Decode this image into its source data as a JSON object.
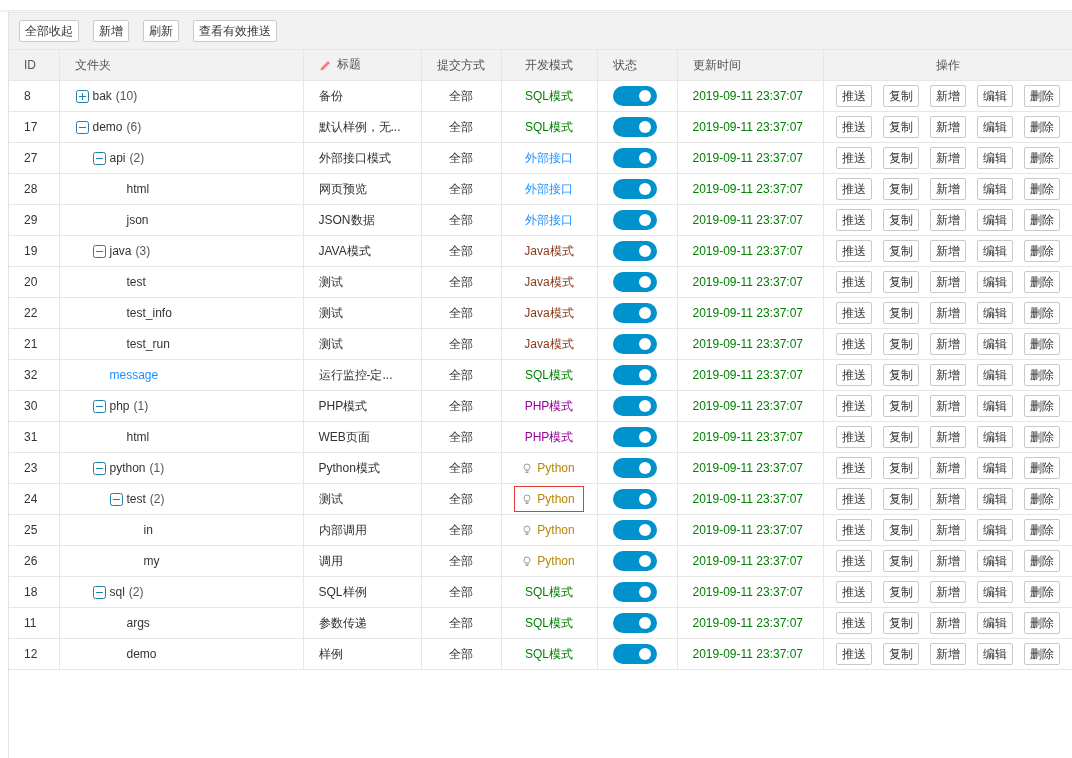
{
  "toolbar": {
    "buttons": [
      "全部收起",
      "新增",
      "刷新",
      "查看有效推送"
    ]
  },
  "table": {
    "columns": [
      "ID",
      "文件夹",
      "标题",
      "提交方式",
      "开发模式",
      "状态",
      "更新时间",
      "操作"
    ],
    "rows": [
      {
        "id": "8",
        "name": "bak",
        "count": "(10)",
        "kind": "folder",
        "expanded": false,
        "title": "备份",
        "submit": "全部",
        "mode": {
          "kind": "sql",
          "label": "SQL模式"
        },
        "on": true,
        "highlighted": false,
        "time": "2019-09-11 23:37:07",
        "actions": [
          "推送",
          "复制",
          "新增",
          "编辑",
          "删除"
        ]
      },
      {
        "id": "17",
        "name": "demo",
        "count": "(6)",
        "kind": "folder",
        "expanded": true,
        "title": "默认样例，无...",
        "submit": "全部",
        "mode": {
          "kind": "sql",
          "label": "SQL模式"
        },
        "on": true,
        "highlighted": false,
        "time": "2019-09-11 23:37:07",
        "actions": [
          "推送",
          "复制",
          "新增",
          "编辑",
          "删除"
        ],
        "children": [
          {
            "id": "27",
            "name": "api",
            "count": "(2)",
            "kind": "folder",
            "expanded": true,
            "title": "外部接口模式",
            "submit": "全部",
            "mode": {
              "kind": "api",
              "label": "外部接口"
            },
            "on": true,
            "highlighted": false,
            "time": "2019-09-11 23:37:07",
            "actions": [
              "推送",
              "复制",
              "新增",
              "编辑",
              "删除"
            ],
            "children": [
              {
                "id": "28",
                "name": "html",
                "kind": "leaf",
                "title": "网页预览",
                "submit": "全部",
                "mode": {
                  "kind": "api",
                  "label": "外部接口"
                },
                "on": true,
                "highlighted": false,
                "time": "2019-09-11 23:37:07",
                "actions": [
                  "推送",
                  "复制",
                  "新增",
                  "编辑",
                  "删除"
                ]
              },
              {
                "id": "29",
                "name": "json",
                "kind": "leaf",
                "title": "JSON数据",
                "submit": "全部",
                "mode": {
                  "kind": "api",
                  "label": "外部接口"
                },
                "on": true,
                "highlighted": false,
                "time": "2019-09-11 23:37:07",
                "actions": [
                  "推送",
                  "复制",
                  "新增",
                  "编辑",
                  "删除"
                ]
              }
            ]
          },
          {
            "id": "19",
            "name": "java",
            "count": "(3)",
            "kind": "folder",
            "expanded": true,
            "title": "JAVA模式",
            "submit": "全部",
            "mode": {
              "kind": "java",
              "label": "Java模式"
            },
            "on": true,
            "highlighted": false,
            "time": "2019-09-11 23:37:07",
            "actions": [
              "推送",
              "复制",
              "新增",
              "编辑",
              "删除"
            ],
            "children": [
              {
                "id": "20",
                "name": "test",
                "kind": "leaf",
                "title": "测试",
                "submit": "全部",
                "mode": {
                  "kind": "java",
                  "label": "Java模式"
                },
                "on": true,
                "highlighted": false,
                "time": "2019-09-11 23:37:07",
                "actions": [
                  "推送",
                  "复制",
                  "新增",
                  "编辑",
                  "删除"
                ]
              },
              {
                "id": "22",
                "name": "test_info",
                "kind": "leaf",
                "title": "测试",
                "submit": "全部",
                "mode": {
                  "kind": "java",
                  "label": "Java模式"
                },
                "on": true,
                "highlighted": false,
                "time": "2019-09-11 23:37:07",
                "actions": [
                  "推送",
                  "复制",
                  "新增",
                  "编辑",
                  "删除"
                ]
              },
              {
                "id": "21",
                "name": "test_run",
                "kind": "leaf",
                "title": "测试",
                "submit": "全部",
                "mode": {
                  "kind": "java",
                  "label": "Java模式"
                },
                "on": true,
                "highlighted": false,
                "time": "2019-09-11 23:37:07",
                "actions": [
                  "推送",
                  "复制",
                  "新增",
                  "编辑",
                  "删除"
                ]
              }
            ]
          },
          {
            "id": "32",
            "name": "message",
            "kind": "link",
            "title": "运行监控-定...",
            "submit": "全部",
            "mode": {
              "kind": "sql",
              "label": "SQL模式"
            },
            "on": true,
            "highlighted": false,
            "time": "2019-09-11 23:37:07",
            "actions": [
              "推送",
              "复制",
              "新增",
              "编辑",
              "删除"
            ]
          },
          {
            "id": "30",
            "name": "php",
            "count": "(1)",
            "kind": "folder",
            "expanded": true,
            "title": "PHP模式",
            "submit": "全部",
            "mode": {
              "kind": "php",
              "label": "PHP模式"
            },
            "on": true,
            "highlighted": false,
            "time": "2019-09-11 23:37:07",
            "actions": [
              "推送",
              "复制",
              "新增",
              "编辑",
              "删除"
            ],
            "children": [
              {
                "id": "31",
                "name": "html",
                "kind": "leaf",
                "title": "WEB页面",
                "submit": "全部",
                "mode": {
                  "kind": "php",
                  "label": "PHP模式"
                },
                "on": true,
                "highlighted": false,
                "time": "2019-09-11 23:37:07",
                "actions": [
                  "推送",
                  "复制",
                  "新增",
                  "编辑",
                  "删除"
                ]
              }
            ]
          },
          {
            "id": "23",
            "name": "python",
            "count": "(1)",
            "kind": "folder",
            "expanded": true,
            "title": "Python模式",
            "submit": "全部",
            "mode": {
              "kind": "python",
              "label": "Python"
            },
            "on": true,
            "highlighted": false,
            "time": "2019-09-11 23:37:07",
            "actions": [
              "推送",
              "复制",
              "新增",
              "编辑",
              "删除"
            ],
            "children": [
              {
                "id": "24",
                "name": "test",
                "count": "(2)",
                "kind": "folder",
                "expanded": true,
                "title": "测试",
                "submit": "全部",
                "mode": {
                  "kind": "python",
                  "label": "Python"
                },
                "on": true,
                "highlighted": true,
                "time": "2019-09-11 23:37:07",
                "actions": [
                  "推送",
                  "复制",
                  "新增",
                  "编辑",
                  "删除"
                ],
                "children": [
                  {
                    "id": "25",
                    "name": "in",
                    "kind": "leaf",
                    "title": "内部调用",
                    "submit": "全部",
                    "mode": {
                      "kind": "python",
                      "label": "Python"
                    },
                    "on": true,
                    "highlighted": false,
                    "time": "2019-09-11 23:37:07",
                    "actions": [
                      "推送",
                      "复制",
                      "新增",
                      "编辑",
                      "删除"
                    ]
                  },
                  {
                    "id": "26",
                    "name": "my",
                    "kind": "leaf",
                    "title": "调用",
                    "submit": "全部",
                    "mode": {
                      "kind": "python",
                      "label": "Python"
                    },
                    "on": true,
                    "highlighted": false,
                    "time": "2019-09-11 23:37:07",
                    "actions": [
                      "推送",
                      "复制",
                      "新增",
                      "编辑",
                      "删除"
                    ]
                  }
                ]
              }
            ]
          },
          {
            "id": "18",
            "name": "sql",
            "count": "(2)",
            "kind": "folder",
            "expanded": true,
            "title": "SQL样例",
            "submit": "全部",
            "mode": {
              "kind": "sql",
              "label": "SQL模式"
            },
            "on": true,
            "highlighted": false,
            "time": "2019-09-11 23:37:07",
            "actions": [
              "推送",
              "复制",
              "新增",
              "编辑",
              "删除"
            ],
            "children": [
              {
                "id": "11",
                "name": "args",
                "kind": "leaf",
                "title": "参数传递",
                "submit": "全部",
                "mode": {
                  "kind": "sql",
                  "label": "SQL模式"
                },
                "on": true,
                "highlighted": false,
                "time": "2019-09-11 23:37:07",
                "actions": [
                  "推送",
                  "复制",
                  "新增",
                  "编辑",
                  "删除"
                ]
              },
              {
                "id": "12",
                "name": "demo",
                "kind": "leaf",
                "title": "样例",
                "submit": "全部",
                "mode": {
                  "kind": "sql",
                  "label": "SQL模式"
                },
                "on": true,
                "highlighted": false,
                "time": "2019-09-11 23:37:07",
                "actions": [
                  "推送",
                  "复制",
                  "新增",
                  "编辑",
                  "删除"
                ]
              }
            ]
          }
        ]
      }
    ]
  }
}
